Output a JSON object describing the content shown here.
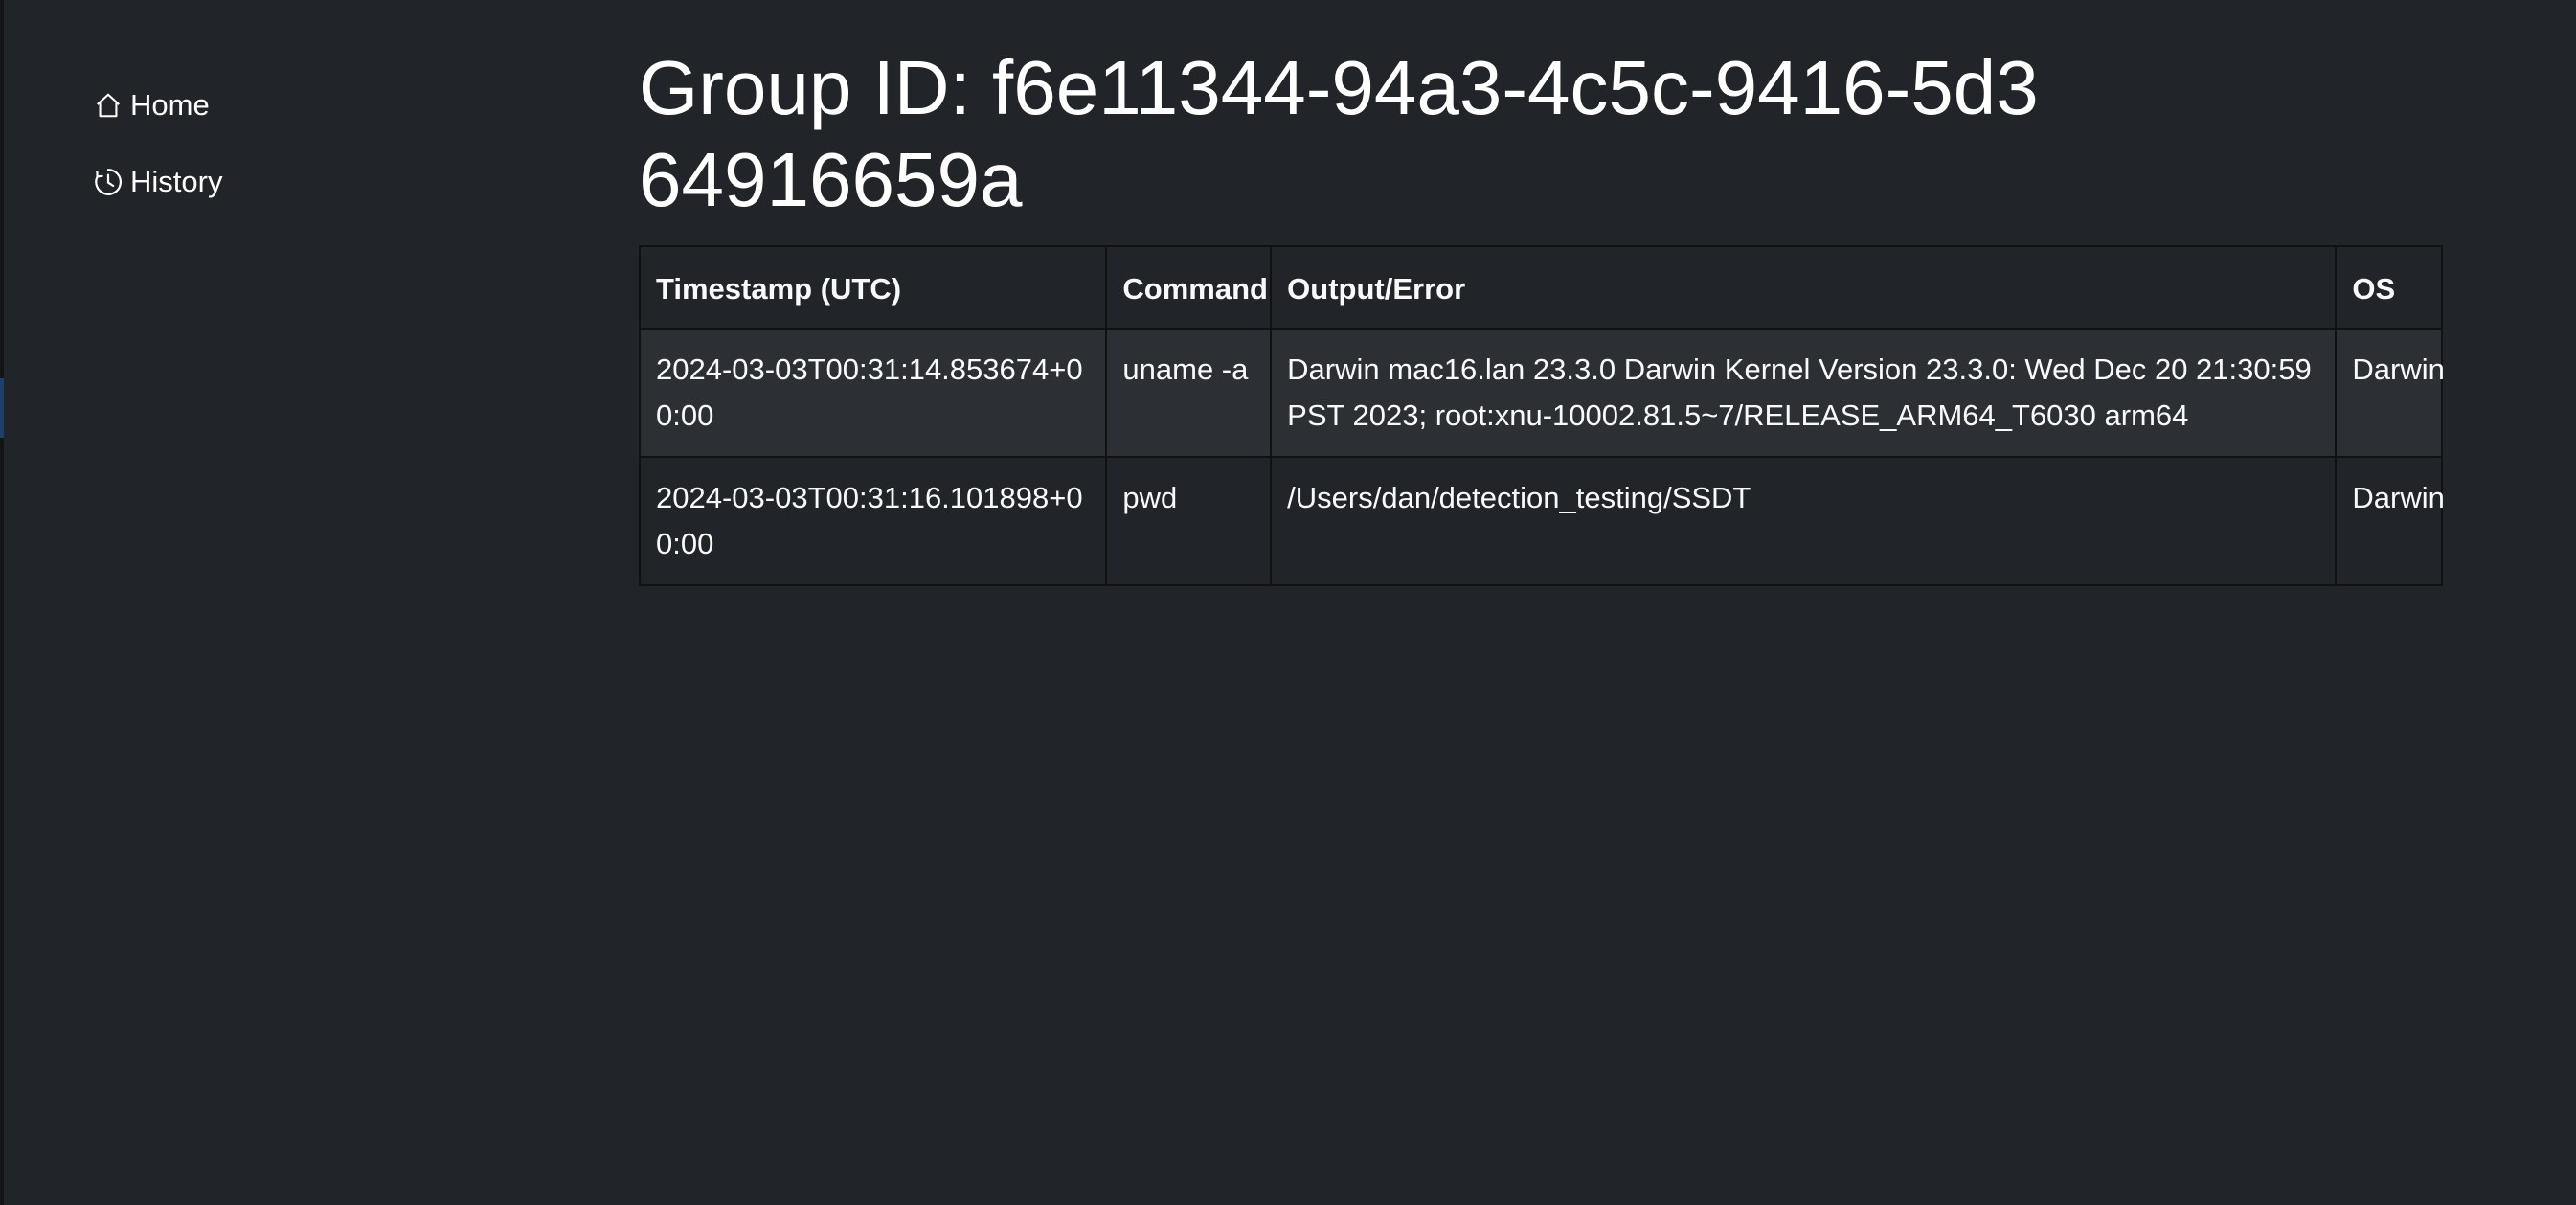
{
  "sidebar": {
    "items": [
      {
        "label": "Home",
        "icon": "home-icon"
      },
      {
        "label": "History",
        "icon": "history-icon"
      }
    ]
  },
  "page": {
    "title": "Group ID: f6e11344-94a3-4c5c-9416-5d364916659a"
  },
  "table": {
    "headers": [
      "Timestamp (UTC)",
      "Command",
      "Output/Error",
      "OS"
    ],
    "rows": [
      {
        "timestamp": "2024-03-03T00:31:14.853674+00:00",
        "command": "uname -a",
        "output": "Darwin mac16.lan 23.3.0 Darwin Kernel Version 23.3.0: Wed Dec 20 21:30:59 PST 2023; root:xnu-10002.81.5~7/RELEASE_ARM64_T6030 arm64",
        "os": "Darwin"
      },
      {
        "timestamp": "2024-03-03T00:31:16.101898+00:00",
        "command": "pwd",
        "output": "/Users/dan/detection_testing/SSDT",
        "os": "Darwin"
      }
    ]
  },
  "colors": {
    "background": "#212529",
    "striped_row": "#2c3034",
    "border": "#0f1113",
    "text": "#f8f9fa"
  }
}
